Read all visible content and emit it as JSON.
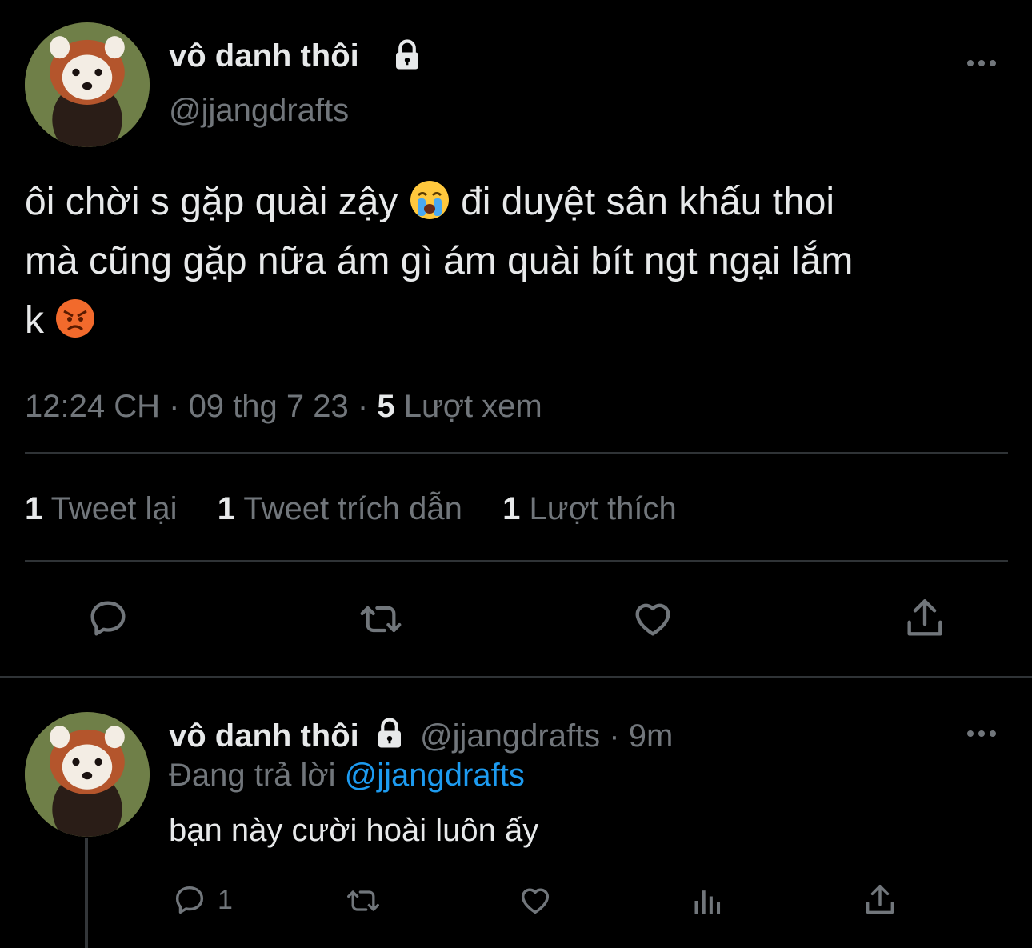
{
  "main_tweet": {
    "display_name": "vô danh thôi",
    "handle": "@jjangdrafts",
    "text_line1": "ôi chời s gặp quài zậy",
    "text_line1b": "đi duyệt sân khấu thoi",
    "text_line2": "mà cũng gặp nữa ám gì ám quài bít ngt ngại lắm",
    "text_line3": "k",
    "emoji1": "crying-face",
    "emoji2": "angry-face",
    "time": "12:24 CH",
    "date": "09 thg 7 23",
    "views_count": "5",
    "views_label": "Lượt xem",
    "retweets_count": "1",
    "retweets_label": "Tweet lại",
    "quotes_count": "1",
    "quotes_label": "Tweet trích dẫn",
    "likes_count": "1",
    "likes_label": "Lượt thích",
    "sep": "·"
  },
  "reply": {
    "display_name": "vô danh thôi",
    "handle": "@jjangdrafts",
    "time": "9m",
    "sep": "·",
    "replying_prefix": "Đang trả lời",
    "replying_to": "@jjangdrafts",
    "text": "bạn này cười hoài luôn ấy",
    "reply_count": "1"
  },
  "colors": {
    "background": "#000000",
    "text": "#e7e9ea",
    "muted": "#71767b",
    "link": "#1d9bf0",
    "divider": "#2f3336"
  }
}
